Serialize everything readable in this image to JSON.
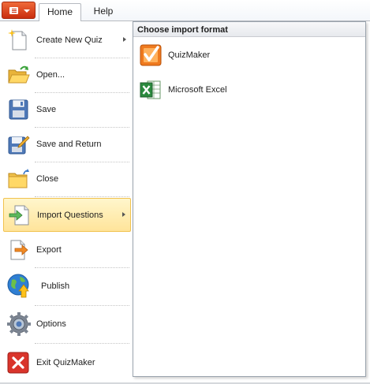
{
  "ribbon": {
    "app_menu_icon": "app-menu-icon",
    "tabs": [
      {
        "label": "Home"
      },
      {
        "label": "Help"
      }
    ]
  },
  "backstage": {
    "items": [
      {
        "label": "Create New Quiz",
        "icon": "new-document-icon",
        "has_submenu": true
      },
      {
        "label": "Open...",
        "icon": "folder-open-icon"
      },
      {
        "label": "Save",
        "icon": "floppy-disk-icon"
      },
      {
        "label": "Save and Return",
        "icon": "save-and-return-icon"
      },
      {
        "label": "Close",
        "icon": "folder-close-icon"
      },
      {
        "label": "Import Questions",
        "icon": "import-icon",
        "has_submenu": true,
        "selected": true
      },
      {
        "label": "Export",
        "icon": "export-icon"
      },
      {
        "label": "Publish",
        "icon": "globe-publish-icon"
      },
      {
        "label": "Options",
        "icon": "gear-icon"
      },
      {
        "label": "Exit QuizMaker",
        "icon": "exit-icon"
      }
    ]
  },
  "submenu": {
    "title": "Choose import format",
    "options": [
      {
        "label": "QuizMaker",
        "icon": "quizmaker-icon"
      },
      {
        "label": "Microsoft Excel",
        "icon": "excel-icon"
      }
    ]
  },
  "colors": {
    "app_button": "#d9401a",
    "selected_item_bg": "#ffe49a",
    "selected_item_border": "#f1c24e"
  }
}
